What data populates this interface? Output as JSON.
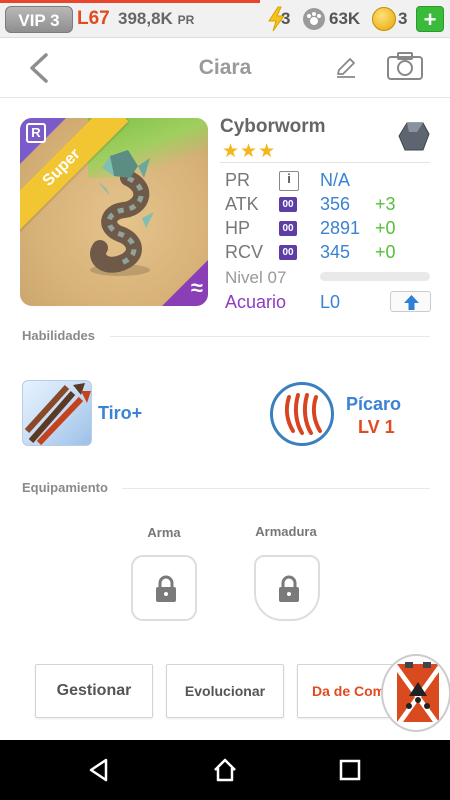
{
  "status_bar": {
    "vip": "VIP 3",
    "level": "L67",
    "power": "398,8K",
    "power_unit": "PR",
    "energy": "3",
    "food": "63K",
    "coins": "3",
    "add_label": "+"
  },
  "header": {
    "title": "Ciara"
  },
  "monster": {
    "rarity_letter": "R",
    "tier": "Super",
    "element_symbol": "≈",
    "name": "Cyborworm",
    "stars": "★★★",
    "stats": [
      {
        "label": "PR",
        "icon": "i",
        "value": "N/A",
        "bonus": ""
      },
      {
        "label": "ATK",
        "icon": "00",
        "value": "356",
        "bonus": "+3"
      },
      {
        "label": "HP",
        "icon": "00",
        "value": "2891",
        "bonus": "+0"
      },
      {
        "label": "RCV",
        "icon": "00",
        "value": "345",
        "bonus": "+0"
      }
    ],
    "level_text": "Nivel 07",
    "level_progress": 0.0,
    "element": "Acuario",
    "limit_level": "L0"
  },
  "abilities": {
    "section_label": "Habilidades",
    "active_name": "Tiro+",
    "passive_name": "Pícaro",
    "passive_level": "LV 1"
  },
  "equipment": {
    "section_label": "Equipamiento",
    "weapon_label": "Arma",
    "armor_label": "Armadura"
  },
  "actions": {
    "manage": "Gestionar",
    "evolve": "Evolucionar",
    "third": "Da de Com"
  },
  "colors": {
    "accent_blue": "#3a82d3",
    "accent_red": "#e24a1f",
    "bonus_green": "#55c03a",
    "element_purple": "#8d3cc0",
    "star_yellow": "#f3b71d"
  }
}
